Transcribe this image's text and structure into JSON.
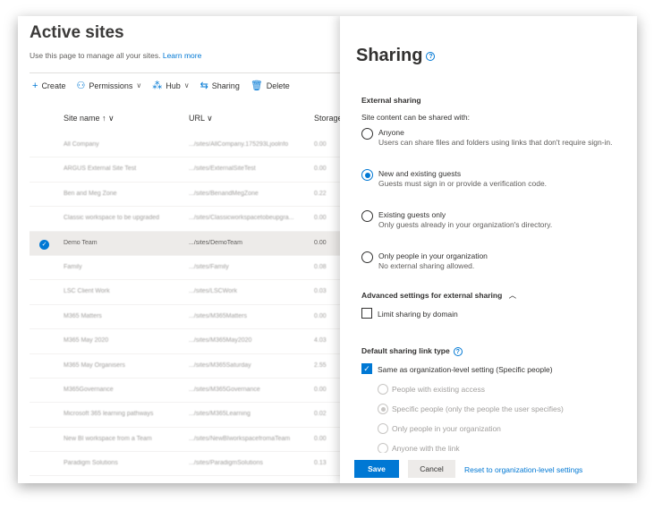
{
  "left": {
    "title": "Active sites",
    "subtitle": "Use this page to manage all your sites.",
    "learn_more": "Learn more",
    "toolbar": [
      {
        "icon": "+",
        "label": "Create",
        "chev": ""
      },
      {
        "icon": "⚇",
        "label": "Permissions",
        "chev": "∨"
      },
      {
        "icon": "⁂",
        "label": "Hub",
        "chev": "∨"
      },
      {
        "icon": "⇆",
        "label": "Sharing",
        "chev": ""
      },
      {
        "icon": "🗑",
        "label": "Delete",
        "chev": ""
      }
    ],
    "headers": {
      "name": "Site name ↑ ∨",
      "url": "URL ∨",
      "storage": "Storage"
    },
    "rows": [
      {
        "name": "All Company",
        "url": ".../sites/AllCompany.175293Ljoolnfo",
        "storage": "0.00"
      },
      {
        "name": "ARGUS External Site Test",
        "url": ".../sites/ExternalSiteTest",
        "storage": "0.00"
      },
      {
        "name": "Ben and Meg Zone",
        "url": ".../sites/BenandMegZone",
        "storage": "0.22"
      },
      {
        "name": "Classic workspace to be upgraded",
        "url": ".../sites/Classicworkspacetobeupgra...",
        "storage": "0.00"
      },
      {
        "name": "Demo Team",
        "url": ".../sites/DemoTeam",
        "storage": "0.00"
      },
      {
        "name": "Family",
        "url": ".../sites/Family",
        "storage": "0.08"
      },
      {
        "name": "LSC Client Work",
        "url": ".../sites/LSCWork",
        "storage": "0.03"
      },
      {
        "name": "M365 Matters",
        "url": ".../sites/M365Matters",
        "storage": "0.00"
      },
      {
        "name": "M365 May 2020",
        "url": ".../sites/M365May2020",
        "storage": "4.03"
      },
      {
        "name": "M365 May Organisers",
        "url": ".../sites/M365Saturday",
        "storage": "2.55"
      },
      {
        "name": "M365Governance",
        "url": ".../sites/M365Governance",
        "storage": "0.00"
      },
      {
        "name": "Microsoft 365 learning pathways",
        "url": ".../sites/M365Learning",
        "storage": "0.02"
      },
      {
        "name": "New BI workspace from a Team",
        "url": ".../sites/NewBIworkspacefromaTeam",
        "storage": "0.00"
      },
      {
        "name": "Paradigm Solutions",
        "url": ".../sites/ParadigmSolutions",
        "storage": "0.13"
      }
    ]
  },
  "panel": {
    "title": "Sharing",
    "external_sharing": "External sharing",
    "can_be_shared": "Site content can be shared with:",
    "options": [
      {
        "label": "Anyone",
        "desc": "Users can share files and folders using links that don't require sign-in.",
        "selected": false
      },
      {
        "label": "New and existing guests",
        "desc": "Guests must sign in or provide a verification code.",
        "selected": true
      },
      {
        "label": "Existing guests only",
        "desc": "Only guests already in your organization's directory.",
        "selected": false
      },
      {
        "label": "Only people in your organization",
        "desc": "No external sharing allowed.",
        "selected": false
      }
    ],
    "advanced": "Advanced settings for external sharing",
    "limit_domain": "Limit sharing by domain",
    "default_link": "Default sharing link type",
    "same_as_org": "Same as organization-level setting (Specific people)",
    "link_options": [
      {
        "label": "People with existing access",
        "selected": false
      },
      {
        "label": "Specific people (only the people the user specifies)",
        "selected": true
      },
      {
        "label": "Only people in your organization",
        "selected": false
      },
      {
        "label": "Anyone with the link",
        "selected": false
      }
    ],
    "save": "Save",
    "cancel": "Cancel",
    "reset": "Reset to organization-level settings"
  }
}
